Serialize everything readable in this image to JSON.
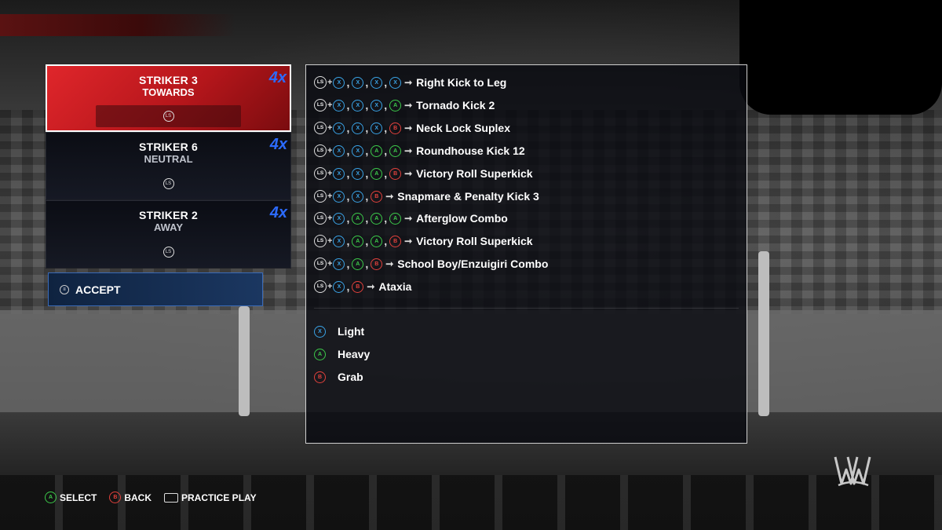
{
  "move_list": [
    {
      "label": "STRIKER 3",
      "sub": "TOWARDS",
      "badge": "4x",
      "input": "LS",
      "selected": true
    },
    {
      "label": "STRIKER 6",
      "sub": "NEUTRAL",
      "badge": "4x",
      "input": "LS",
      "selected": false
    },
    {
      "label": "STRIKER 2",
      "sub": "AWAY",
      "badge": "4x",
      "input": "LS",
      "selected": false
    }
  ],
  "accept": {
    "label": "ACCEPT"
  },
  "combo_panel": {
    "ls_label": "LS",
    "combos": [
      {
        "buttons": [
          "X",
          "X",
          "X",
          "X"
        ],
        "name": "Right Kick to Leg"
      },
      {
        "buttons": [
          "X",
          "X",
          "X",
          "A"
        ],
        "name": "Tornado Kick 2"
      },
      {
        "buttons": [
          "X",
          "X",
          "X",
          "B"
        ],
        "name": "Neck Lock Suplex"
      },
      {
        "buttons": [
          "X",
          "X",
          "A",
          "A"
        ],
        "name": "Roundhouse Kick 12"
      },
      {
        "buttons": [
          "X",
          "X",
          "A",
          "B"
        ],
        "name": "Victory Roll Superkick"
      },
      {
        "buttons": [
          "X",
          "X",
          "B"
        ],
        "name": "Snapmare & Penalty Kick 3"
      },
      {
        "buttons": [
          "X",
          "A",
          "A",
          "A"
        ],
        "name": "Afterglow Combo"
      },
      {
        "buttons": [
          "X",
          "A",
          "A",
          "B"
        ],
        "name": "Victory Roll Superkick"
      },
      {
        "buttons": [
          "X",
          "A",
          "B"
        ],
        "name": "School Boy/Enzuigiri Combo"
      },
      {
        "buttons": [
          "X",
          "B"
        ],
        "name": "Ataxia"
      }
    ],
    "legend": [
      {
        "button": "X",
        "label": "Light"
      },
      {
        "button": "A",
        "label": "Heavy"
      },
      {
        "button": "B",
        "label": "Grab"
      }
    ]
  },
  "footer": {
    "select": {
      "button": "A",
      "label": "SELECT"
    },
    "back": {
      "button": "B",
      "label": "BACK"
    },
    "practice": {
      "label": "PRACTICE PLAY"
    }
  },
  "colors": {
    "x": "#3aa3e6",
    "a": "#3cc94a",
    "b": "#e2413c",
    "selected": "#d8212a",
    "badge": "#2c6bff"
  }
}
